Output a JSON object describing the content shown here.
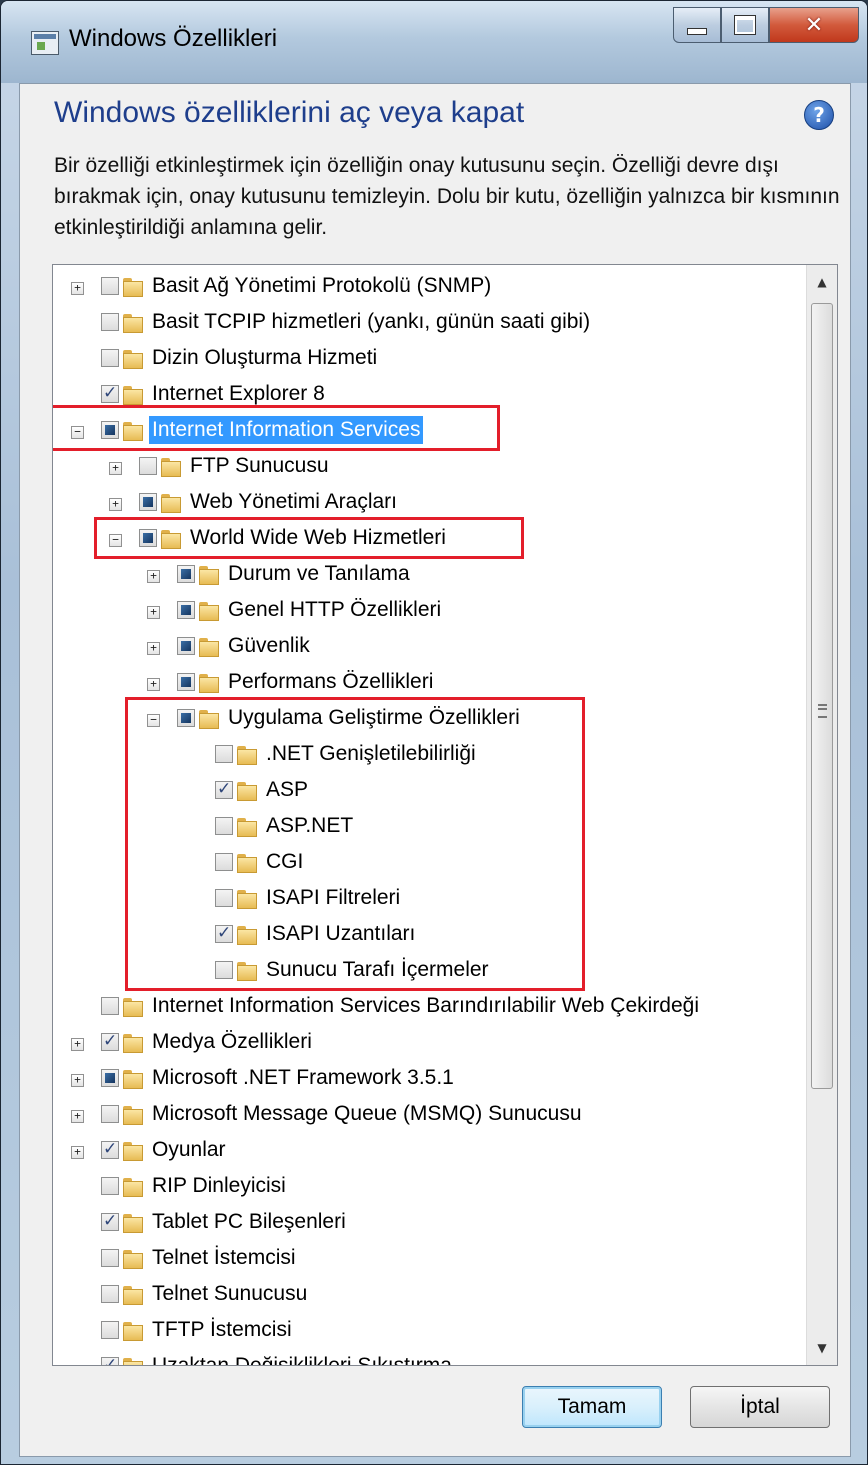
{
  "window": {
    "title": "Windows Özellikleri"
  },
  "dialog": {
    "heading": "Windows özelliklerini aç veya kapat",
    "description": "Bir özelliği etkinleştirmek için özelliğin onay kutusunu seçin. Özelliği devre dışı bırakmak için, onay kutusunu temizleyin. Dolu bir kutu, özelliğin yalnızca bir kısmının etkinleştirildiği anlamına gelir."
  },
  "colors": {
    "heading": "#1e3e8c",
    "selection": "#3399ff",
    "highlight_box": "#e31e2a"
  },
  "tree": {
    "items": [
      {
        "label": "Basit Ağ Yönetimi Protokolü (SNMP)",
        "level": 0,
        "expander": "+",
        "state": "unchecked"
      },
      {
        "label": "Basit TCPIP hizmetleri (yankı, günün saati gibi)",
        "level": 0,
        "expander": "",
        "state": "unchecked"
      },
      {
        "label": "Dizin Oluşturma Hizmeti",
        "level": 0,
        "expander": "",
        "state": "unchecked"
      },
      {
        "label": "Internet Explorer 8",
        "level": 0,
        "expander": "",
        "state": "checked"
      },
      {
        "label": "Internet Information Services",
        "level": 0,
        "expander": "−",
        "state": "partial",
        "selected": true
      },
      {
        "label": "FTP Sunucusu",
        "level": 1,
        "expander": "+",
        "state": "unchecked"
      },
      {
        "label": "Web Yönetimi Araçları",
        "level": 1,
        "expander": "+",
        "state": "partial"
      },
      {
        "label": "World Wide Web Hizmetleri",
        "level": 1,
        "expander": "−",
        "state": "partial"
      },
      {
        "label": "Durum ve Tanılama",
        "level": 2,
        "expander": "+",
        "state": "partial"
      },
      {
        "label": "Genel HTTP Özellikleri",
        "level": 2,
        "expander": "+",
        "state": "partial"
      },
      {
        "label": "Güvenlik",
        "level": 2,
        "expander": "+",
        "state": "partial"
      },
      {
        "label": "Performans Özellikleri",
        "level": 2,
        "expander": "+",
        "state": "partial"
      },
      {
        "label": "Uygulama Geliştirme Özellikleri",
        "level": 2,
        "expander": "−",
        "state": "partial"
      },
      {
        "label": ".NET Genişletilebilirliği",
        "level": 3,
        "expander": "",
        "state": "unchecked"
      },
      {
        "label": "ASP",
        "level": 3,
        "expander": "",
        "state": "checked"
      },
      {
        "label": "ASP.NET",
        "level": 3,
        "expander": "",
        "state": "unchecked"
      },
      {
        "label": "CGI",
        "level": 3,
        "expander": "",
        "state": "unchecked"
      },
      {
        "label": "ISAPI Filtreleri",
        "level": 3,
        "expander": "",
        "state": "unchecked"
      },
      {
        "label": "ISAPI Uzantıları",
        "level": 3,
        "expander": "",
        "state": "checked"
      },
      {
        "label": "Sunucu Tarafı İçermeler",
        "level": 3,
        "expander": "",
        "state": "unchecked"
      },
      {
        "label": "Internet Information Services Barındırılabilir Web Çekirdeği",
        "level": 0,
        "expander": "",
        "state": "unchecked"
      },
      {
        "label": "Medya Özellikleri",
        "level": 0,
        "expander": "+",
        "state": "checked"
      },
      {
        "label": "Microsoft .NET Framework 3.5.1",
        "level": 0,
        "expander": "+",
        "state": "partial"
      },
      {
        "label": "Microsoft Message Queue (MSMQ) Sunucusu",
        "level": 0,
        "expander": "+",
        "state": "unchecked"
      },
      {
        "label": "Oyunlar",
        "level": 0,
        "expander": "+",
        "state": "checked"
      },
      {
        "label": "RIP Dinleyicisi",
        "level": 0,
        "expander": "",
        "state": "unchecked"
      },
      {
        "label": "Tablet PC Bileşenleri",
        "level": 0,
        "expander": "",
        "state": "checked"
      },
      {
        "label": "Telnet İstemcisi",
        "level": 0,
        "expander": "",
        "state": "unchecked"
      },
      {
        "label": "Telnet Sunucusu",
        "level": 0,
        "expander": "",
        "state": "unchecked"
      },
      {
        "label": "TFTP İstemcisi",
        "level": 0,
        "expander": "",
        "state": "unchecked"
      },
      {
        "label": "Uzaktan Değişiklikleri Sıkıştırma",
        "level": 0,
        "expander": "",
        "state": "checked"
      }
    ]
  },
  "buttons": {
    "ok": "Tamam",
    "cancel": "İptal"
  }
}
